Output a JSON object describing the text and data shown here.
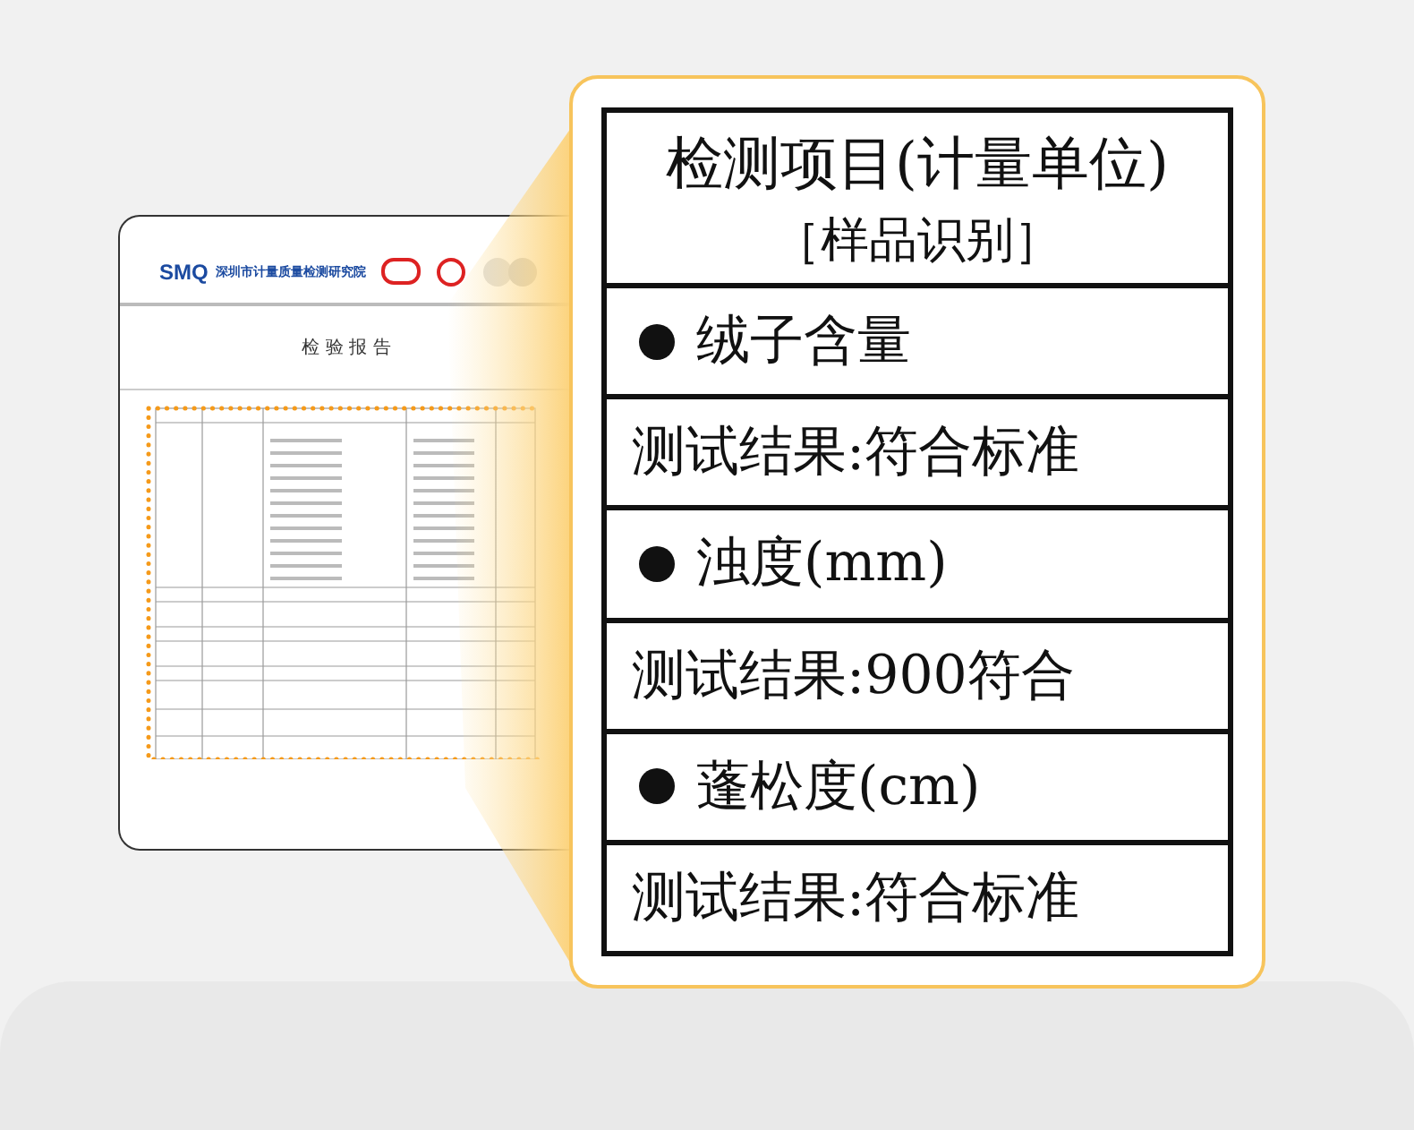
{
  "document": {
    "logo": "SMQ",
    "institute": "深圳市计量质量检测研究院",
    "title": "检 验 报 告"
  },
  "magnifier": {
    "header": "检测项目(计量单位)",
    "subheader": "［样品识别］",
    "rows": [
      {
        "kind": "item",
        "text": "绒子含量"
      },
      {
        "kind": "result",
        "text": "测试结果:符合标准"
      },
      {
        "kind": "item",
        "text": "浊度(mm)"
      },
      {
        "kind": "result",
        "text": "测试结果:900符合"
      },
      {
        "kind": "item",
        "text": "蓬松度(cm)"
      },
      {
        "kind": "result",
        "text": "测试结果:符合标准"
      }
    ]
  }
}
